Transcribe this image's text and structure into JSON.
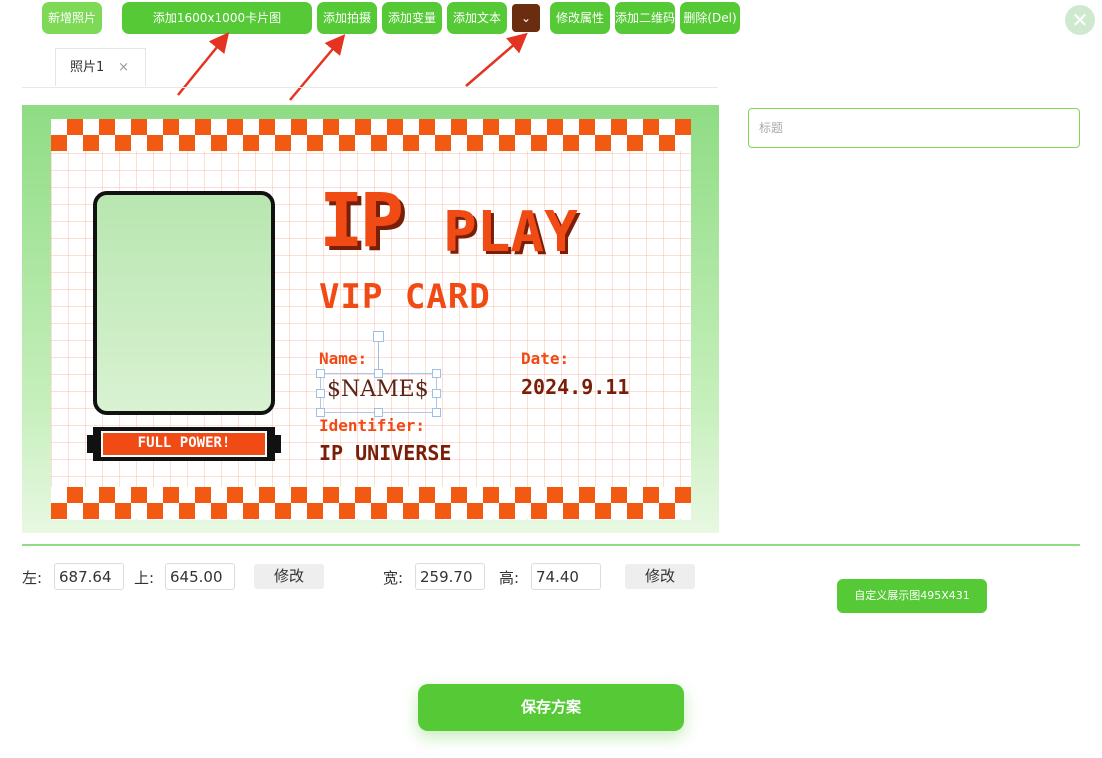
{
  "toolbar": {
    "new_photo": "新增照片",
    "add_card_image": "添加1600x1000卡片图",
    "add_shoot": "添加拍摄",
    "add_variable": "添加变量",
    "add_text": "添加文本",
    "dropdown_icon": "chevron-down-icon",
    "modify_props": "修改属性",
    "add_qrcode": "添加二维码",
    "delete": "删除(Del)"
  },
  "tabs": [
    {
      "label": "照片1",
      "close": "×"
    }
  ],
  "card": {
    "ip": "IP",
    "play": "PLAY",
    "vip": "VIP CARD",
    "name_label": "Name:",
    "name_value": "$NAME$",
    "date_label": "Date:",
    "date_value": "2024.9.11",
    "identifier_label": "Identifier:",
    "identifier_value": "IP UNIVERSE",
    "power_badge": "FULL POWER!"
  },
  "title_field": {
    "placeholder": "标题",
    "value": ""
  },
  "props": {
    "left_label": "左:",
    "left_value": "687.64",
    "top_label": "上:",
    "top_value": "645.00",
    "modify1": "修改",
    "width_label": "宽:",
    "width_value": "259.70",
    "height_label": "高:",
    "height_value": "74.40",
    "modify2": "修改"
  },
  "custom_display": "自定义展示图495X431",
  "save": "保存方案",
  "colors": {
    "accent": "#55c936",
    "card_orange": "#f04a15",
    "card_dark": "#7a1e08"
  }
}
